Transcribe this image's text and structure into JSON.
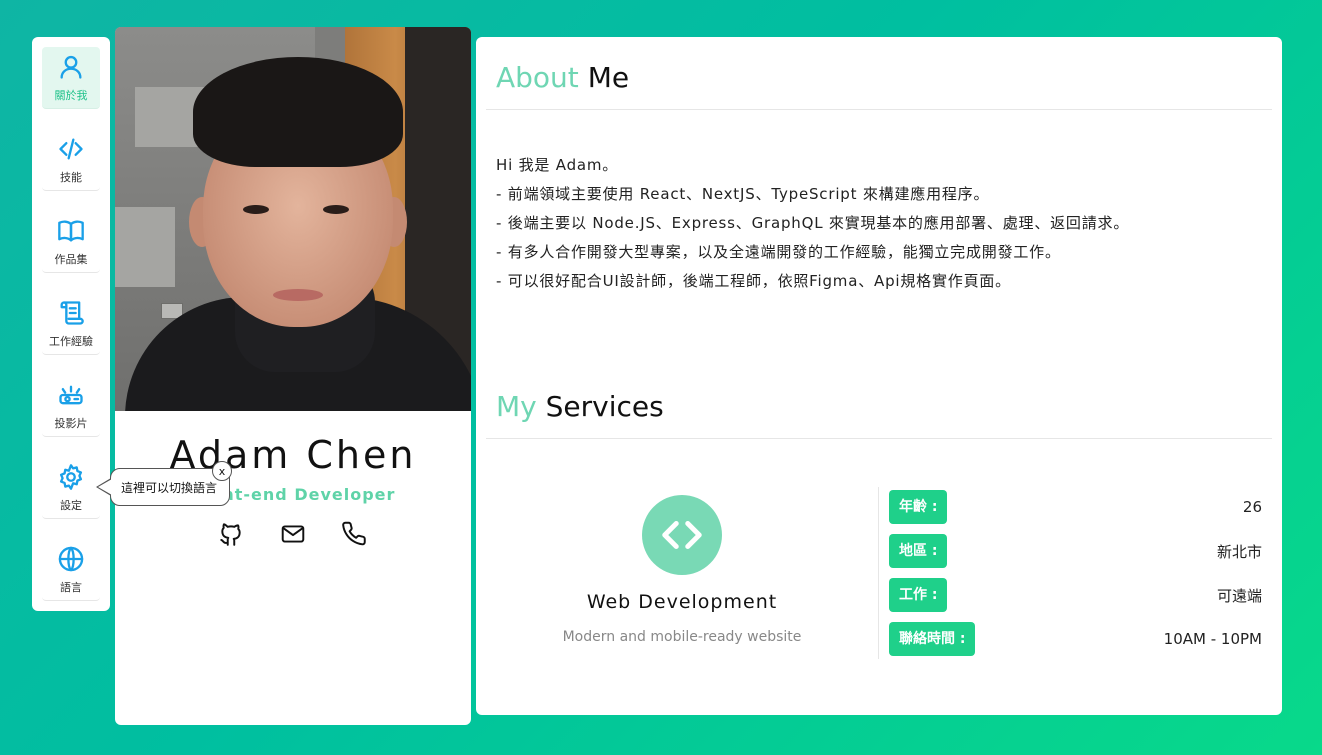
{
  "sidebar": {
    "items": [
      {
        "label": "關於我",
        "icon": "user-icon",
        "active": true
      },
      {
        "label": "技能",
        "icon": "code-icon",
        "active": false
      },
      {
        "label": "作品集",
        "icon": "book-icon",
        "active": false
      },
      {
        "label": "工作經驗",
        "icon": "scroll-icon",
        "active": false
      },
      {
        "label": "投影片",
        "icon": "projector-icon",
        "active": false
      },
      {
        "label": "設定",
        "icon": "gear-icon",
        "active": false
      },
      {
        "label": "語言",
        "icon": "globe-icon",
        "active": false
      }
    ]
  },
  "tooltip": {
    "text": "這裡可以切換語言",
    "close_label": "x"
  },
  "profile": {
    "name": "Adam Chen",
    "role": "Front-end Developer",
    "socials": [
      "github-icon",
      "mail-icon",
      "phone-icon"
    ]
  },
  "about": {
    "title_accent": "About",
    "title_rest": " Me",
    "lines": [
      "Hi 我是 Adam。",
      "- 前端領域主要使用 React、NextJS、TypeScript 來構建應用程序。",
      "- 後端主要以 Node.JS、Express、GraphQL 來實現基本的應用部署、處理、返回請求。",
      "- 有多人合作開發大型專案，以及全遠端開發的工作經驗，能獨立完成開發工作。",
      "- 可以很好配合UI設計師，後端工程師，依照Figma、Api規格實作頁面。"
    ]
  },
  "services": {
    "title_accent": "My",
    "title_rest": " Services",
    "service": {
      "icon": "code-icon",
      "title": "Web Development",
      "description": "Modern and mobile-ready website"
    },
    "info": [
      {
        "key": "年齡 :",
        "value": "26"
      },
      {
        "key": "地區 :",
        "value": "新北市"
      },
      {
        "key": "工作 :",
        "value": "可遠端"
      },
      {
        "key": "聯絡時間 :",
        "value": "10AM - 10PM"
      }
    ]
  },
  "colors": {
    "accent": "#6fd6b3",
    "badge": "#1fd08a",
    "nav_icon": "#1aa0e8",
    "active_label": "#1fc28a"
  }
}
